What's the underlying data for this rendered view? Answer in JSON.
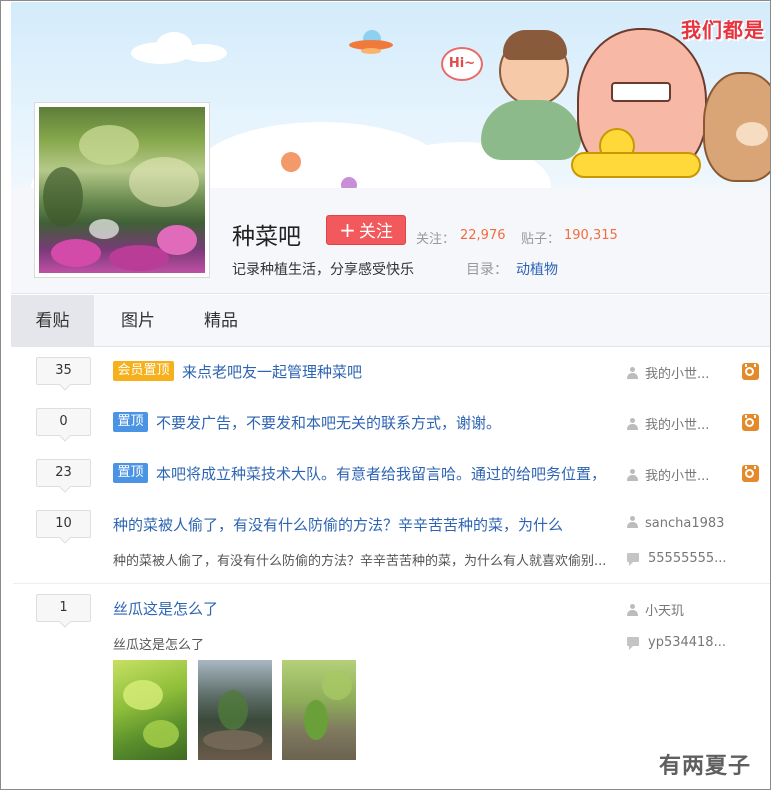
{
  "banner": {
    "slogan": "我们都是",
    "bubble_text": "Hi~"
  },
  "forum": {
    "name": "种菜吧",
    "follow_label": "关注",
    "follow_stat_label": "关注：",
    "follow_count": "22,976",
    "posts_stat_label": "贴子：",
    "posts_count": "190,315",
    "slogan": "记录种植生活，分享感受快乐",
    "catalog_label": "目录：",
    "catalog_value": "动植物"
  },
  "tabs": [
    {
      "label": "看贴",
      "active": true
    },
    {
      "label": "图片",
      "active": false
    },
    {
      "label": "精品",
      "active": false
    }
  ],
  "threads": [
    {
      "replies": "35",
      "tag": "会员置顶",
      "title": "来点老吧友一起管理种菜吧",
      "author": "我的小世...",
      "moderator": true
    },
    {
      "replies": "0",
      "tag": "置顶",
      "title": "不要发广告，不要发和本吧无关的联系方式，谢谢。",
      "author": "我的小世...",
      "moderator": true
    },
    {
      "replies": "23",
      "tag": "置顶",
      "title": "本吧将成立种菜技术大队。有意者给我留言哈。通过的给吧务位置，",
      "author": "我的小世...",
      "moderator": true
    },
    {
      "replies": "10",
      "title": "种的菜被人偷了，有没有什么防偷的方法？辛辛苦苦种的菜，为什么",
      "abstract": "种的菜被人偷了，有没有什么防偷的方法？辛辛苦苦种的菜，为什么有人就喜欢偷别...",
      "author": "sancha1983",
      "last_reply": "55555555..."
    },
    {
      "replies": "1",
      "title": "丝瓜这是怎么了",
      "abstract": "丝瓜这是怎么了",
      "author": "小天玑",
      "last_reply": "yp534418..."
    }
  ],
  "watermark": "有两夏子",
  "colors": {
    "follow_button": "#f2595c",
    "tag_member": "#f5b01c",
    "tag_top": "#4b93e3",
    "link": "#2d64b3",
    "stat_value": "#f36c3e"
  }
}
